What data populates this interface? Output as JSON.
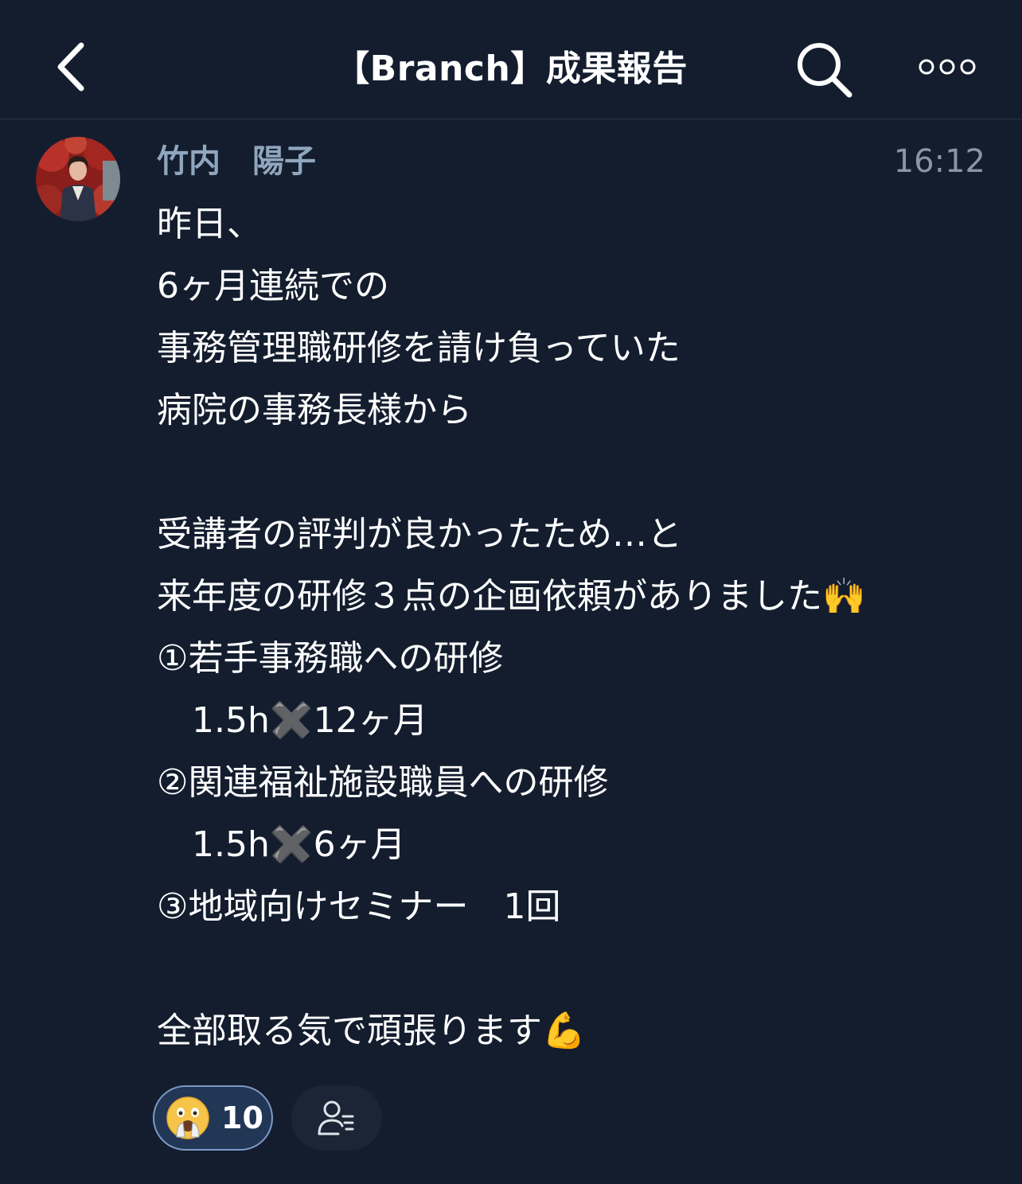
{
  "header": {
    "title": "【Branch】成果報告",
    "back_icon": "chevron-left-icon",
    "search_icon": "search-icon",
    "more_icon": "more-dots-icon"
  },
  "message": {
    "sender": "竹内　陽子",
    "time": "16:12",
    "body": "昨日、\n6ヶ月連続での\n事務管理職研修を請け負っていた\n病院の事務長様から\n\n受講者の評判が良かったため…と\n来年度の研修３点の企画依頼がありました🙌\n①若手事務職への研修\n　1.5h✖️12ヶ月\n②関連福祉施設職員への研修\n　1.5h✖️6ヶ月\n③地域向けセミナー　1回\n\n全部取る気で頑張ります💪"
  },
  "reactions": [
    {
      "emoji": "face-with-open-mouth-and-hands-icon",
      "count": "10"
    }
  ],
  "read_status_icon": "read-users-icon",
  "colors": {
    "background": "#131d2e",
    "sender_name": "#8fa6bd",
    "time": "#8b95a3",
    "reaction_bg": "#223656",
    "reaction_border": "#7d9ac5"
  }
}
